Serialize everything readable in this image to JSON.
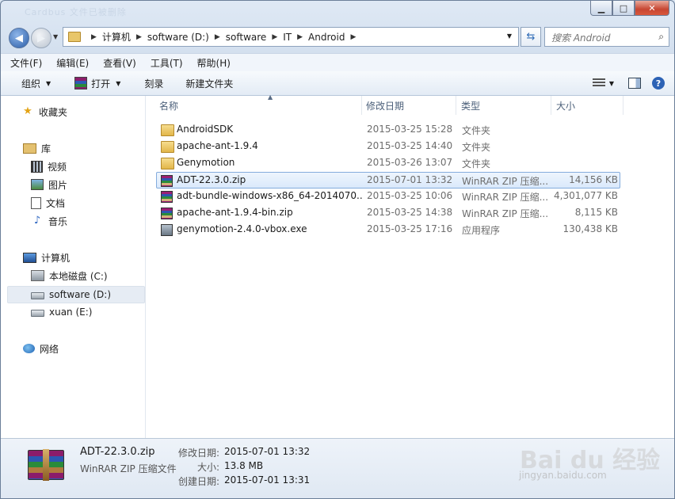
{
  "window": {
    "ghost_title": "Cardbus    文件已被删除",
    "minimize": "▁",
    "maximize": "□",
    "close": "✕"
  },
  "address": {
    "crumbs": [
      "计算机",
      "software (D:)",
      "software",
      "IT",
      "Android"
    ],
    "search_placeholder": "搜索 Android"
  },
  "menu": [
    "文件(F)",
    "编辑(E)",
    "查看(V)",
    "工具(T)",
    "帮助(H)"
  ],
  "toolbar": {
    "organize": "组织",
    "open": "打开",
    "burn": "刻录",
    "new_folder": "新建文件夹"
  },
  "nav": {
    "favorites": "收藏夹",
    "libraries": "库",
    "videos": "视频",
    "pictures": "图片",
    "documents": "文档",
    "music": "音乐",
    "computer": "计算机",
    "drive_c": "本地磁盘 (C:)",
    "drive_d": "software (D:)",
    "drive_e": "xuan (E:)",
    "network": "网络"
  },
  "columns": {
    "name": "名称",
    "date": "修改日期",
    "type": "类型",
    "size": "大小"
  },
  "files": [
    {
      "name": "AndroidSDK",
      "date": "2015-03-25 15:28",
      "type": "文件夹",
      "size": "",
      "icon": "folder-icon"
    },
    {
      "name": "apache-ant-1.9.4",
      "date": "2015-03-25 14:40",
      "type": "文件夹",
      "size": "",
      "icon": "folder-icon"
    },
    {
      "name": "Genymotion",
      "date": "2015-03-26 13:07",
      "type": "文件夹",
      "size": "",
      "icon": "folder-icon"
    },
    {
      "name": "ADT-22.3.0.zip",
      "date": "2015-07-01 13:32",
      "type": "WinRAR ZIP 压缩...",
      "size": "14,156 KB",
      "icon": "winrar-icon"
    },
    {
      "name": "adt-bundle-windows-x86_64-2014070...",
      "date": "2015-03-25 10:06",
      "type": "WinRAR ZIP 压缩...",
      "size": "4,301,077 KB",
      "icon": "winrar-icon"
    },
    {
      "name": "apache-ant-1.9.4-bin.zip",
      "date": "2015-03-25 14:38",
      "type": "WinRAR ZIP 压缩...",
      "size": "8,115 KB",
      "icon": "winrar-icon"
    },
    {
      "name": "genymotion-2.4.0-vbox.exe",
      "date": "2015-03-25 17:16",
      "type": "应用程序",
      "size": "130,438 KB",
      "icon": "installer-icon"
    }
  ],
  "details": {
    "name": "ADT-22.3.0.zip",
    "type": "WinRAR ZIP 压缩文件",
    "modified_label": "修改日期:",
    "modified_value": "2015-07-01 13:32",
    "size_label": "大小:",
    "size_value": "13.8 MB",
    "created_label": "创建日期:",
    "created_value": "2015-07-01 13:31"
  },
  "watermark": {
    "main": "Bai du 经验",
    "sub": "jingyan.baidu.com"
  },
  "colors": {
    "selection_border": "#84acdd",
    "close_button": "#c74632",
    "nav_arrow": "#2b5ea8"
  }
}
